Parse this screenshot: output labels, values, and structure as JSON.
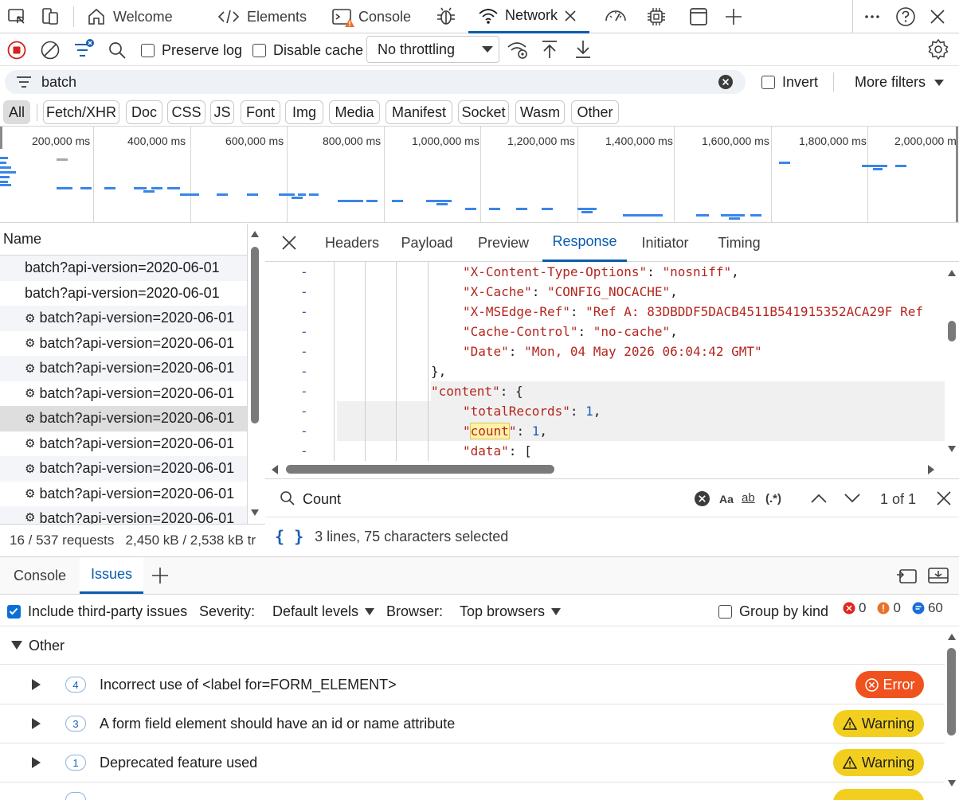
{
  "tabbar": {
    "tabs": [
      {
        "label": "Welcome",
        "icon": "home-icon"
      },
      {
        "label": "Elements",
        "icon": "code-icon"
      },
      {
        "label": "Console",
        "icon": "console-icon"
      },
      {
        "label": "",
        "icon": "bug-icon"
      },
      {
        "label": "Network",
        "icon": "wifi-icon"
      },
      {
        "label": "",
        "icon": "performance-icon"
      },
      {
        "label": "",
        "icon": "cpu-icon"
      },
      {
        "label": "",
        "icon": "application-icon"
      }
    ],
    "active": "Network"
  },
  "toolbar": {
    "preserve_log": "Preserve log",
    "disable_cache": "Disable cache",
    "throttling": "No throttling"
  },
  "filter": {
    "value": "batch",
    "invert": "Invert",
    "more_filters": "More filters"
  },
  "types": [
    "All",
    "Fetch/XHR",
    "Doc",
    "CSS",
    "JS",
    "Font",
    "Img",
    "Media",
    "Manifest",
    "Socket",
    "Wasm",
    "Other"
  ],
  "overview": {
    "ticks": [
      "200,000 ms",
      "400,000 ms",
      "600,000 ms",
      "800,000 ms",
      "1,000,000 ms",
      "1,200,000 ms",
      "1,400,000 ms",
      "1,600,000 ms",
      "1,800,000 ms",
      "2,000,000 m"
    ]
  },
  "requests": {
    "header": "Name",
    "items": [
      {
        "name": "batch?api-version=2020-06-01",
        "gear": false
      },
      {
        "name": "batch?api-version=2020-06-01",
        "gear": false
      },
      {
        "name": "batch?api-version=2020-06-01",
        "gear": true
      },
      {
        "name": "batch?api-version=2020-06-01",
        "gear": true
      },
      {
        "name": "batch?api-version=2020-06-01",
        "gear": true
      },
      {
        "name": "batch?api-version=2020-06-01",
        "gear": true
      },
      {
        "name": "batch?api-version=2020-06-01",
        "gear": true
      },
      {
        "name": "batch?api-version=2020-06-01",
        "gear": true
      },
      {
        "name": "batch?api-version=2020-06-01",
        "gear": true
      },
      {
        "name": "batch?api-version=2020-06-01",
        "gear": true
      },
      {
        "name": "batch?api-version=2020-06-01",
        "gear": true
      }
    ],
    "status": "16 / 537 requests   2,450 kB / 2,538 kB tr"
  },
  "detail": {
    "tabs": [
      "Headers",
      "Payload",
      "Preview",
      "Response",
      "Initiator",
      "Timing"
    ],
    "active": "Response",
    "code_lines": [
      {
        "k": "\"X-Content-Type-Options\"",
        "v": "\"nosniff\",",
        "vt": "str",
        "indent": 6
      },
      {
        "k": "\"X-Cache\"",
        "v": "\"CONFIG_NOCACHE\",",
        "vt": "str",
        "indent": 6
      },
      {
        "k": "\"X-MSEdge-Ref\"",
        "v": "\"Ref A: 83DBDDF5DACB4511B541915352ACA29F Ref",
        "vt": "str",
        "indent": 6
      },
      {
        "k": "\"Cache-Control\"",
        "v": "\"no-cache\",",
        "vt": "str",
        "indent": 6
      },
      {
        "k": "\"Date\"",
        "v": "\"Mon, 04 May 2026 06:04:42 GMT\"",
        "vt": "str",
        "indent": 6
      },
      {
        "k": "",
        "v": "},",
        "vt": "pun",
        "indent": 5
      },
      {
        "k": "\"content\"",
        "v": "{",
        "vt": "pun",
        "indent": 5
      },
      {
        "k": "\"totalRecords\"",
        "v": "1,",
        "vt": "num",
        "indent": 6
      },
      {
        "k": "\"count\"",
        "v": "1,",
        "vt": "num",
        "indent": 6
      },
      {
        "k": "\"data\"",
        "v": "[",
        "vt": "pun",
        "indent": 6
      }
    ],
    "search": {
      "value": "Count",
      "match_case": "Aa",
      "whole_word": "ab",
      "regex": "(.*)",
      "result": "1 of 1"
    },
    "selection_info": "3 lines, 75 characters selected"
  },
  "drawer": {
    "tabs": [
      "Console",
      "Issues"
    ],
    "active": "Issues",
    "include_third_party": "Include third-party issues",
    "severity_label": "Severity:",
    "severity_value": "Default levels",
    "browser_label": "Browser:",
    "browser_value": "Top browsers",
    "group_by_kind": "Group by kind",
    "counts": {
      "errors": "0",
      "warnings": "0",
      "info": "60"
    },
    "group": "Other",
    "issues": [
      {
        "count": "4",
        "title": "Incorrect use of <label for=FORM_ELEMENT>",
        "severity": "Error",
        "type": "err"
      },
      {
        "count": "3",
        "title": "A form field element should have an id or name attribute",
        "severity": "Warning",
        "type": "warn"
      },
      {
        "count": "1",
        "title": "Deprecated feature used",
        "severity": "Warning",
        "type": "warn"
      }
    ]
  },
  "colors": {
    "accent": "#0b5cad",
    "error": "#f0521f",
    "warning": "#f2cf1f",
    "timeline": "#3a86e8"
  }
}
